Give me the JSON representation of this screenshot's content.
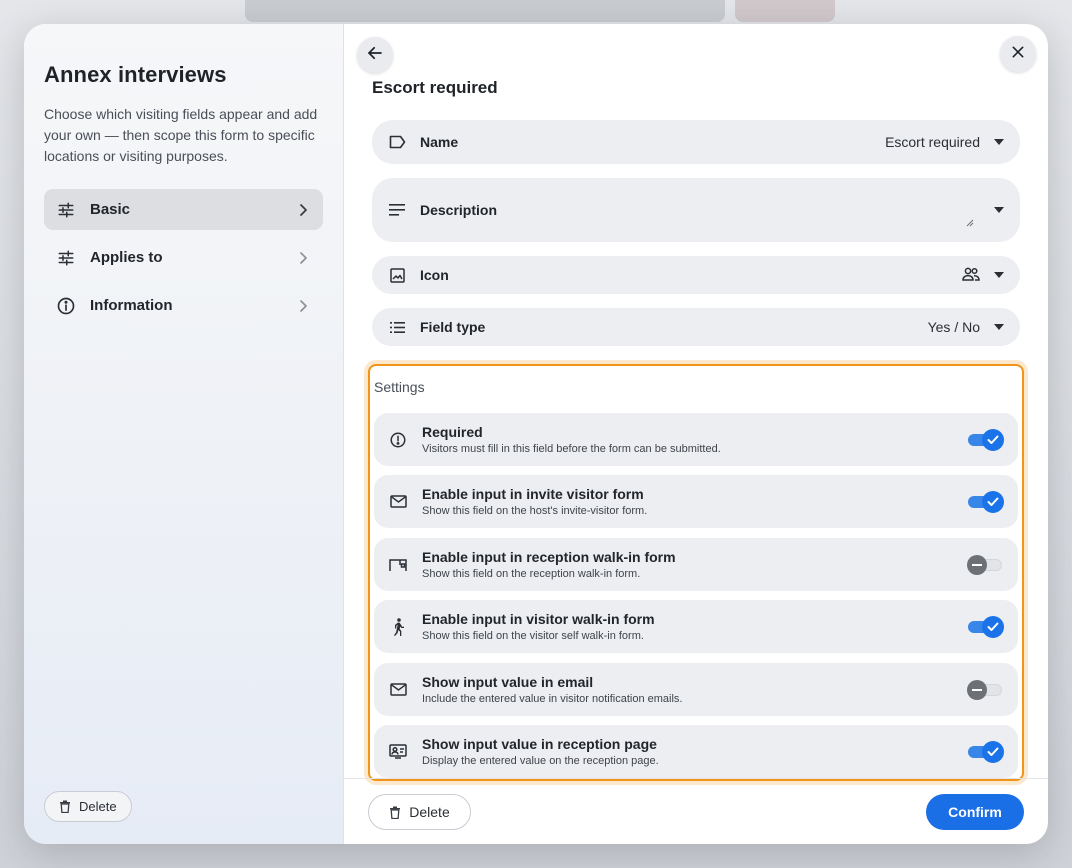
{
  "sidebar": {
    "title": "Annex interviews",
    "description": "Choose which visiting fields appear and add your own — then scope this form to specific locations or visiting purposes.",
    "items": [
      {
        "label": "Basic",
        "icon": "tune-icon",
        "active": true
      },
      {
        "label": "Applies to",
        "icon": "tune-icon",
        "active": false
      },
      {
        "label": "Information",
        "icon": "info-icon",
        "active": false
      }
    ],
    "delete_label": "Delete"
  },
  "form": {
    "title": "Escort required",
    "name": {
      "label": "Name",
      "value": "Escort required"
    },
    "description": {
      "label": "Description",
      "value": ""
    },
    "icon": {
      "label": "Icon",
      "value_icon": "people-icon"
    },
    "field_type": {
      "label": "Field type",
      "value": "Yes / No"
    }
  },
  "settings": {
    "title": "Settings",
    "rows": [
      {
        "label": "Required",
        "sub": "Visitors must fill in this field before the form can be submitted.",
        "icon": "alert-circle-icon",
        "on": true
      },
      {
        "label": "Enable input in invite visitor form",
        "sub": "Show this field on the host's invite-visitor form.",
        "icon": "mail-icon",
        "on": true
      },
      {
        "label": "Enable input in reception walk-in form",
        "sub": "Show this field on the reception walk-in form.",
        "icon": "reception-desk-icon",
        "on": false
      },
      {
        "label": "Enable input in visitor walk-in form",
        "sub": "Show this field on the visitor self walk-in form.",
        "icon": "walking-person-icon",
        "on": true
      },
      {
        "label": "Show input value in email",
        "sub": "Include the entered value in visitor notification emails.",
        "icon": "mail-icon",
        "on": false
      },
      {
        "label": "Show input value in reception page",
        "sub": "Display the entered value on the reception page.",
        "icon": "badge-icon",
        "on": true
      }
    ]
  },
  "footer": {
    "delete_label": "Delete",
    "confirm_label": "Confirm"
  },
  "colors": {
    "accent": "#1a6ee6",
    "highlight": "#f0951a"
  }
}
